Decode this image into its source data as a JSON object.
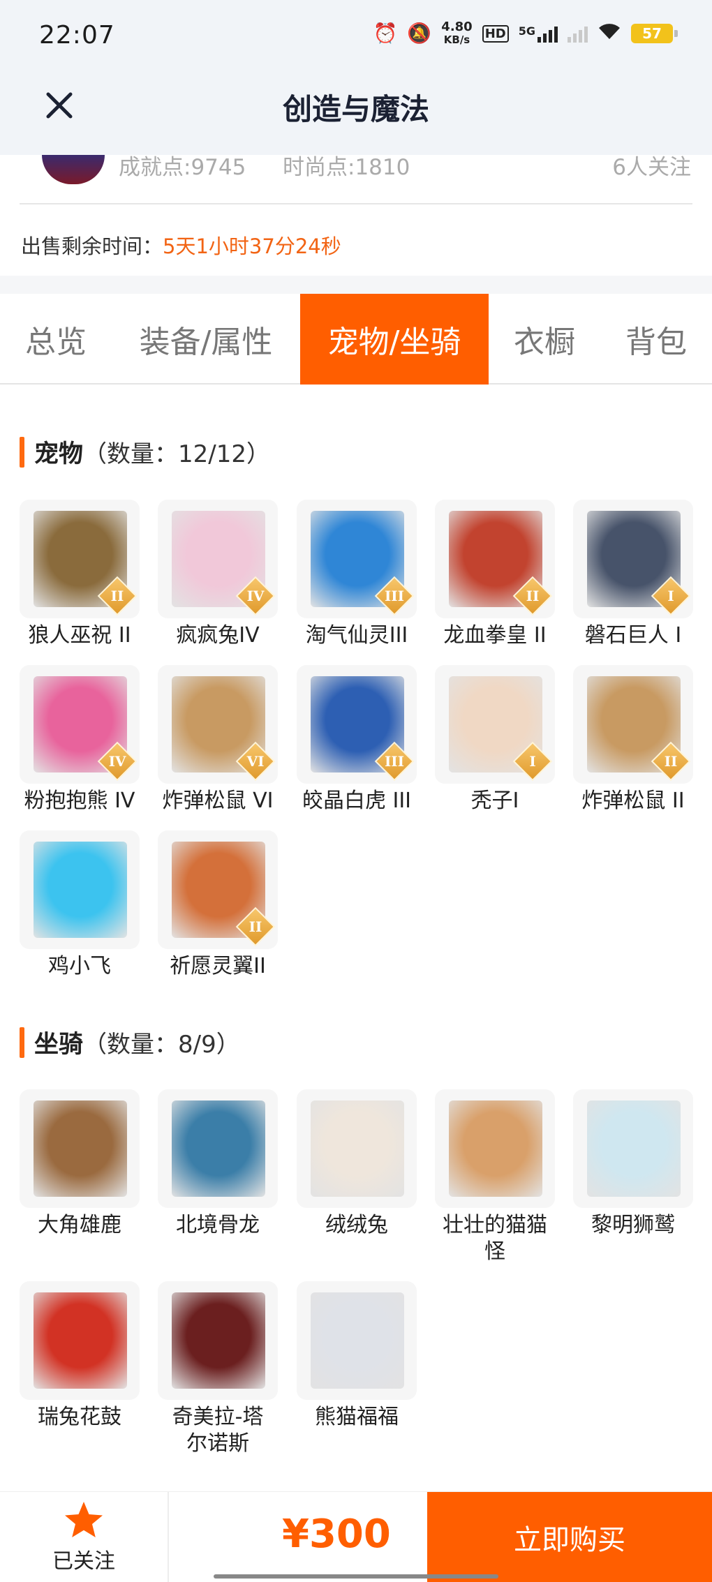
{
  "status_bar": {
    "time": "22:07",
    "net_speed_value": "4.80",
    "net_speed_unit": "KB/s",
    "hd": "HD",
    "network": "5G",
    "battery": "57"
  },
  "header": {
    "title": "创造与魔法"
  },
  "profile": {
    "achievement": "成就点:9745",
    "fashion": "时尚点:1810",
    "followers": "6人关注",
    "sale_label": "出售剩余时间：",
    "sale_value": "5天1小时37分24秒"
  },
  "tabs": [
    {
      "label": "总览",
      "active": false
    },
    {
      "label": "装备/属性",
      "active": false
    },
    {
      "label": "宠物/坐骑",
      "active": true
    },
    {
      "label": "衣橱",
      "active": false
    },
    {
      "label": "背包",
      "active": false
    }
  ],
  "pets": {
    "title": "宠物",
    "count": "（数量：12/12）",
    "items": [
      {
        "name": "狼人巫祝 II",
        "badge": "II",
        "color": "#8a6b3c"
      },
      {
        "name": "疯疯兔IV",
        "badge": "IV",
        "color": "#f1c8d9"
      },
      {
        "name": "淘气仙灵III",
        "badge": "III",
        "color": "#2f86d6"
      },
      {
        "name": "龙血拳皇 II",
        "badge": "II",
        "color": "#c2432f"
      },
      {
        "name": "磐石巨人 I",
        "badge": "I",
        "color": "#47536a"
      },
      {
        "name": "粉抱抱熊 IV",
        "badge": "IV",
        "color": "#e8639c"
      },
      {
        "name": "炸弹松鼠 VI",
        "badge": "VI",
        "color": "#c89a62"
      },
      {
        "name": "皎晶白虎 III",
        "badge": "III",
        "color": "#2d5fb3"
      },
      {
        "name": "秃子I",
        "badge": "I",
        "color": "#f0d8c4"
      },
      {
        "name": "炸弹松鼠 II",
        "badge": "II",
        "color": "#c89a62"
      },
      {
        "name": "鸡小飞",
        "badge": "",
        "color": "#3cc3ef"
      },
      {
        "name": "祈愿灵翼II",
        "badge": "II",
        "color": "#d4703a"
      }
    ]
  },
  "mounts": {
    "title": "坐骑",
    "count": "（数量：8/9）",
    "items": [
      {
        "name": "大角雄鹿",
        "color": "#9a6a3f"
      },
      {
        "name": "北境骨龙",
        "color": "#3b7ea8"
      },
      {
        "name": "绒绒兔",
        "color": "#efe6dc"
      },
      {
        "name": "壮壮的猫猫怪",
        "color": "#d9a06a"
      },
      {
        "name": "黎明狮鹫",
        "color": "#cfe7f0"
      },
      {
        "name": "瑞兔花鼓",
        "color": "#d23224"
      },
      {
        "name": "奇美拉-塔尔诺斯",
        "color": "#6b1f1f"
      },
      {
        "name": "熊猫福福",
        "color": "#dfe2e8"
      }
    ]
  },
  "bottom": {
    "follow_label": "已关注",
    "price": "¥300",
    "buy_label": "立即购买"
  },
  "colors": {
    "accent": "#ff5e00",
    "sale_time": "#f26414"
  }
}
